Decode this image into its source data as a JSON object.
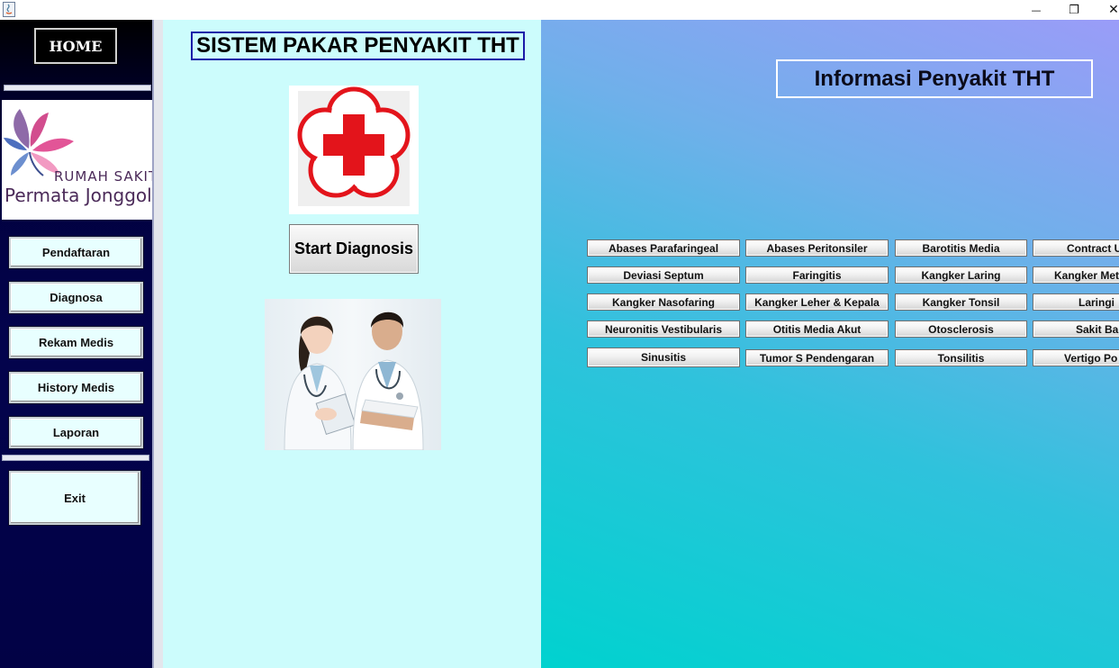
{
  "window": {
    "minimize_glyph": "—",
    "maximize_glyph": "❐",
    "close_glyph": "✕"
  },
  "sidebar": {
    "home_label": "HOME",
    "logo": {
      "line1": "RUMAH SAKIT",
      "line2": "Permata Jonggol"
    },
    "nav_items": [
      {
        "label": "Pendaftaran"
      },
      {
        "label": "Diagnosa"
      },
      {
        "label": "Rekam Medis"
      },
      {
        "label": "History Medis"
      },
      {
        "label": "Laporan"
      }
    ],
    "exit_label": "Exit"
  },
  "main": {
    "title": "SISTEM PAKAR PENYAKIT THT",
    "start_button": "Start Diagnosis"
  },
  "info": {
    "title": "Informasi Penyakit THT",
    "diseases": [
      [
        "Abases Parafaringeal",
        "Abases Peritonsiler",
        "Barotitis Media",
        "Contract U"
      ],
      [
        "Deviasi Septum",
        "Faringitis",
        "Kangker Laring",
        "Kangker Met"
      ],
      [
        "Kangker Nasofaring",
        "Kangker Leher & Kepala",
        "Kangker Tonsil",
        "Laringi"
      ],
      [
        "Neuronitis Vestibularis",
        "Otitis Media Akut",
        "Otosclerosis",
        "Sakit Ba"
      ],
      [
        "Sinusitis",
        "Tumor S Pendengaran",
        "Tonsilitis",
        "Vertigo Po"
      ]
    ]
  },
  "colors": {
    "sidebar_bg": "#02024a",
    "middle_bg": "#ccfcfc",
    "cross_red": "#e3141b",
    "title_border": "#1a1aa8"
  }
}
